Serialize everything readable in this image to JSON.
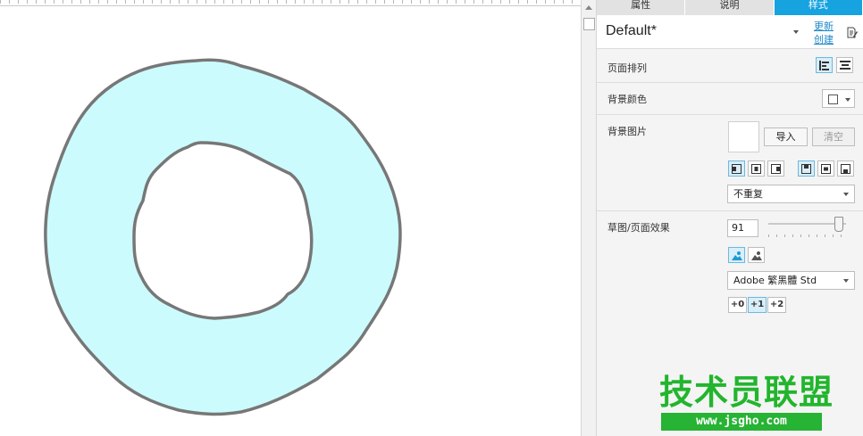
{
  "canvas": {
    "shape_fill": "#ccfbfd",
    "shape_stroke": "#777777"
  },
  "panel": {
    "tabs": [
      {
        "label": "属性",
        "active": false
      },
      {
        "label": "说明",
        "active": false
      },
      {
        "label": "样式",
        "active": true
      }
    ],
    "style": {
      "name": "Default*",
      "update_link": "更新",
      "create_link": "创建"
    },
    "page_align": {
      "label": "页面排列"
    },
    "bg_color": {
      "label": "背景颜色",
      "value": "#ffffff"
    },
    "bg_image": {
      "label": "背景图片",
      "import_label": "导入",
      "clear_label": "清空",
      "repeat_value": "不重复"
    },
    "sketch": {
      "label": "草图/页面效果",
      "value": "91",
      "font_value": "Adobe 繁黑體 Std",
      "offsets": [
        "+0",
        "+1",
        "+2"
      ],
      "active_offset": "+1"
    },
    "accent_color": "#17a2e0"
  },
  "watermark": {
    "title": "技术员联盟",
    "url": "www.jsgho.com"
  }
}
